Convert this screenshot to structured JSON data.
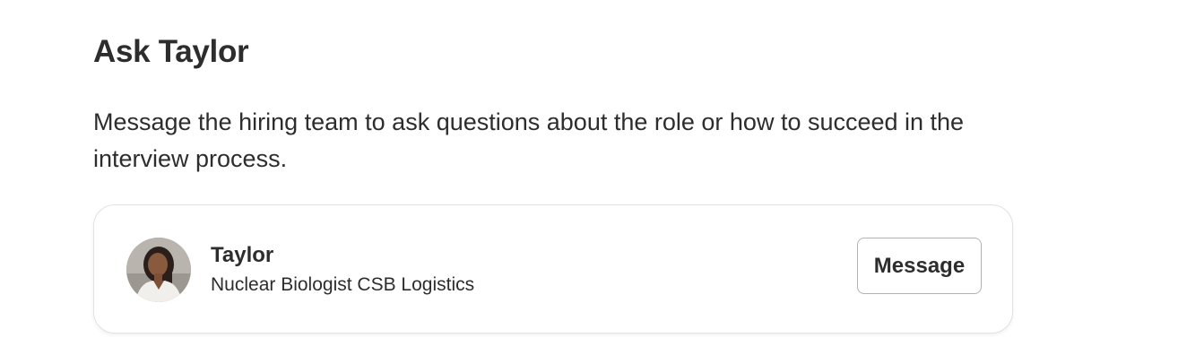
{
  "section": {
    "title": "Ask Taylor",
    "description": "Message the hiring team to ask questions about the role or how to succeed in the interview process."
  },
  "contact": {
    "name": "Taylor",
    "subtitle": "Nuclear Biologist CSB Logistics",
    "avatar_icon": "profile-photo",
    "action_label": "Message"
  },
  "colors": {
    "text": "#2d2d2d",
    "card_border": "#e4e2e0",
    "button_border": "#b4b2b1",
    "background": "#ffffff"
  }
}
